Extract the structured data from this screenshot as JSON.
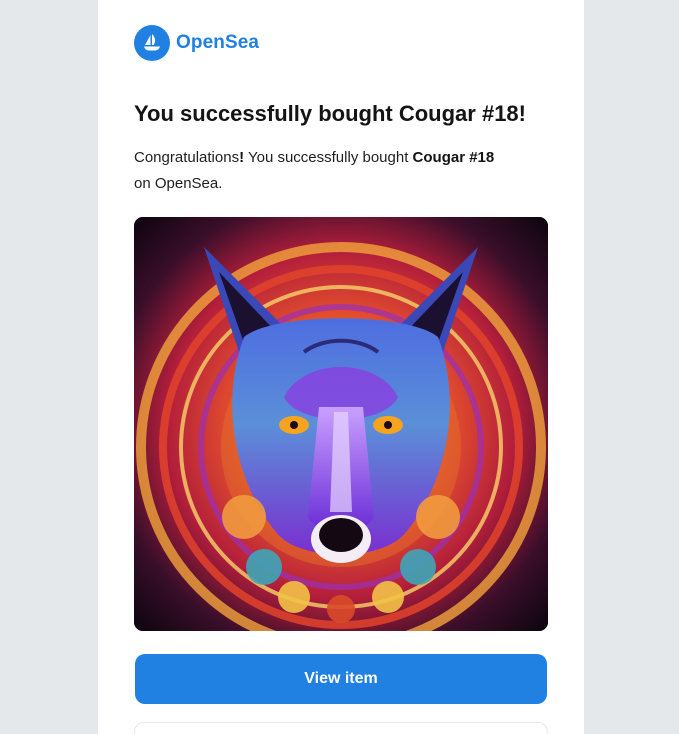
{
  "brand": {
    "name": "OpenSea",
    "logo_icon": "opensea-logo-icon",
    "color": "#2081e2"
  },
  "email": {
    "headline": "You successfully bought Cougar #18!",
    "message_intro": "Congratulations",
    "message_mid": " You successfully bought ",
    "item_name": "Cougar #18",
    "message_end": "on OpenSea."
  },
  "nft": {
    "subject": "cougar-artwork"
  },
  "cta": {
    "label": "View item",
    "color": "#2081e2"
  }
}
